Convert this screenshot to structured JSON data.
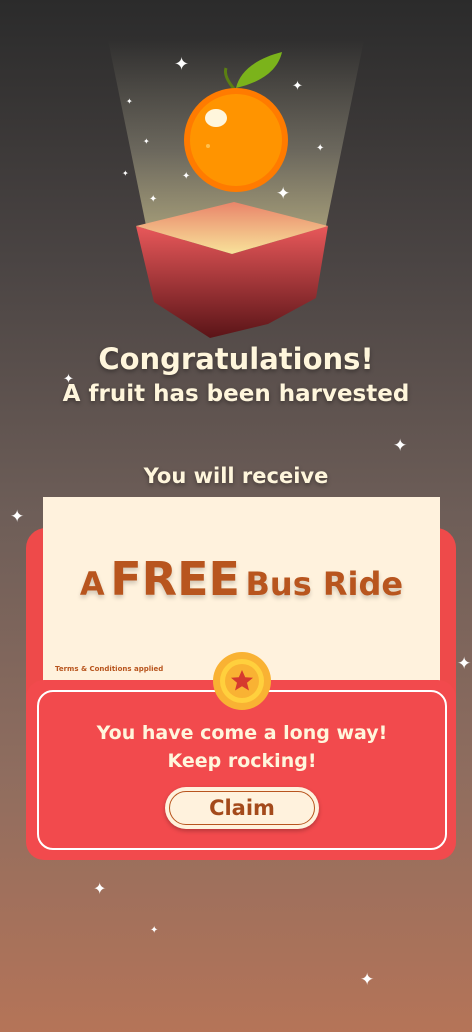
{
  "header": {
    "title": "Congratulations!",
    "subtitle": "A fruit has been harvested"
  },
  "reward": {
    "intro": "You will receive",
    "offer_prefix": "A",
    "offer_highlight": "FREE",
    "offer_suffix": "Bus Ride",
    "terms": "Terms & Conditions applied"
  },
  "panel": {
    "message_line1": "You have come a long way!",
    "message_line2": "Keep rocking!",
    "claim_label": "Claim"
  },
  "icons": {
    "fruit": "orange-icon",
    "box": "gift-box-icon",
    "medal": "star-medal-icon",
    "sparkle": "sparkle-icon"
  },
  "colors": {
    "accent_red": "#f24a4d",
    "ticket_bg": "#fff2dd",
    "offer_text": "#b8551e",
    "orange": "#ff8a00",
    "leaf": "#7bb31b",
    "gold": "#f9b233"
  }
}
